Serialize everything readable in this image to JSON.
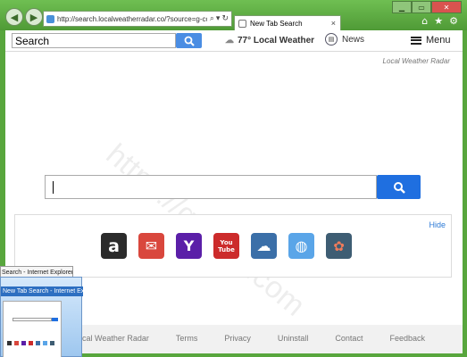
{
  "browser": {
    "address_url": "http://search.localweatherradar.co/?source=g-ccc",
    "tab_title": "New Tab Search",
    "tab_close": "×",
    "right_icons": [
      "home-icon",
      "star-icon",
      "gear-icon"
    ]
  },
  "toolbar": {
    "search_placeholder": "Search",
    "weather_text": "77° Local Weather",
    "news_label": "News",
    "menu_label": "Menu"
  },
  "brand": "Local Weather Radar",
  "apps_panel": {
    "hide_label": "Hide",
    "apps": [
      {
        "name": "amazon",
        "glyph": "a",
        "color": "#2b2b2b"
      },
      {
        "name": "mail",
        "glyph": "✉",
        "color": "#d9473d"
      },
      {
        "name": "yahoo",
        "glyph": "Y",
        "color": "#5b1fa8"
      },
      {
        "name": "youtube",
        "glyph": "You\nTube",
        "color": "#cc2b2b"
      },
      {
        "name": "weather",
        "glyph": "☁",
        "color": "#3b6fa8"
      },
      {
        "name": "globe",
        "glyph": "◍",
        "color": "#5aa5e8"
      },
      {
        "name": "maps",
        "glyph": "✿",
        "color": "#3e5d73"
      }
    ]
  },
  "footer": {
    "links": [
      "Local Weather Radar",
      "Terms",
      "Privacy",
      "Uninstall",
      "Contact",
      "Feedback"
    ]
  },
  "watermark": "https://greatis.com",
  "taskbar_preview": {
    "tooltip": "Search - Internet Explorer",
    "window_title": "New Tab Search - Internet Explo..."
  },
  "colors": {
    "frame": "#58a63d",
    "search_button": "#1f6fe0",
    "link": "#2d7ad6"
  }
}
